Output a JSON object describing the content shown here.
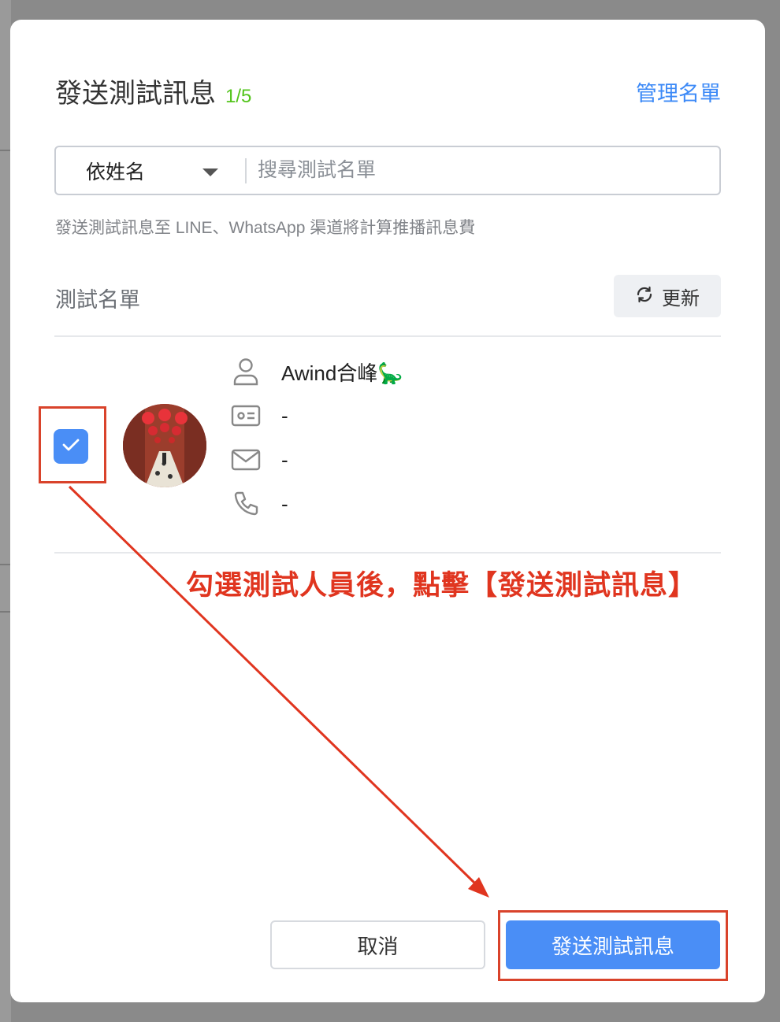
{
  "modal": {
    "title": "發送測試訊息",
    "count": "1/5",
    "manage_link": "管理名單",
    "search": {
      "filter_label": "依姓名",
      "placeholder": "搜尋測試名單"
    },
    "notice": "發送測試訊息至 LINE、WhatsApp 渠道將計算推播訊息費",
    "list_title": "測試名單",
    "refresh_label": "更新",
    "contact": {
      "checked": true,
      "name": "Awind合峰🦕",
      "id_value": "-",
      "email_value": "-",
      "phone_value": "-"
    },
    "cancel_label": "取消",
    "send_label": "發送測試訊息"
  },
  "annotation": {
    "text": "勾選測試人員後，點擊【發送測試訊息】",
    "color": "#e0351f"
  },
  "colors": {
    "accent": "#4a8ef6",
    "link": "#3d8af7",
    "count": "#52c41a",
    "highlight": "#d9432b"
  }
}
